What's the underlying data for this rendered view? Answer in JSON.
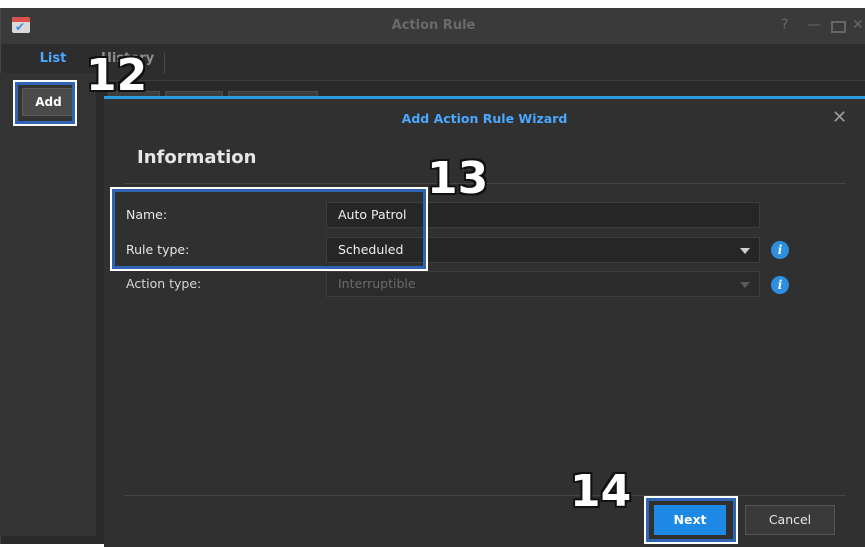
{
  "window": {
    "title": "Action Rule"
  },
  "tabs": [
    {
      "label": "List"
    },
    {
      "label": "History"
    }
  ],
  "toolbar": {
    "add_label": "Add"
  },
  "dialog": {
    "title": "Add Action Rule Wizard",
    "section_title": "Information",
    "fields": [
      {
        "label": "Name:",
        "value": "Auto Patrol"
      },
      {
        "label": "Rule type:",
        "value": "Scheduled"
      },
      {
        "label": "Action type:",
        "value": "Interruptible"
      }
    ],
    "next_label": "Next",
    "cancel_label": "Cancel"
  },
  "step_badges": {
    "add": "12",
    "fields": "13",
    "next": "14"
  },
  "colors": {
    "accent": "#2d9be0",
    "highlight_border": "#2f64b3",
    "primary_button": "#1e88e5",
    "window_bg": "#2a2a2a"
  }
}
